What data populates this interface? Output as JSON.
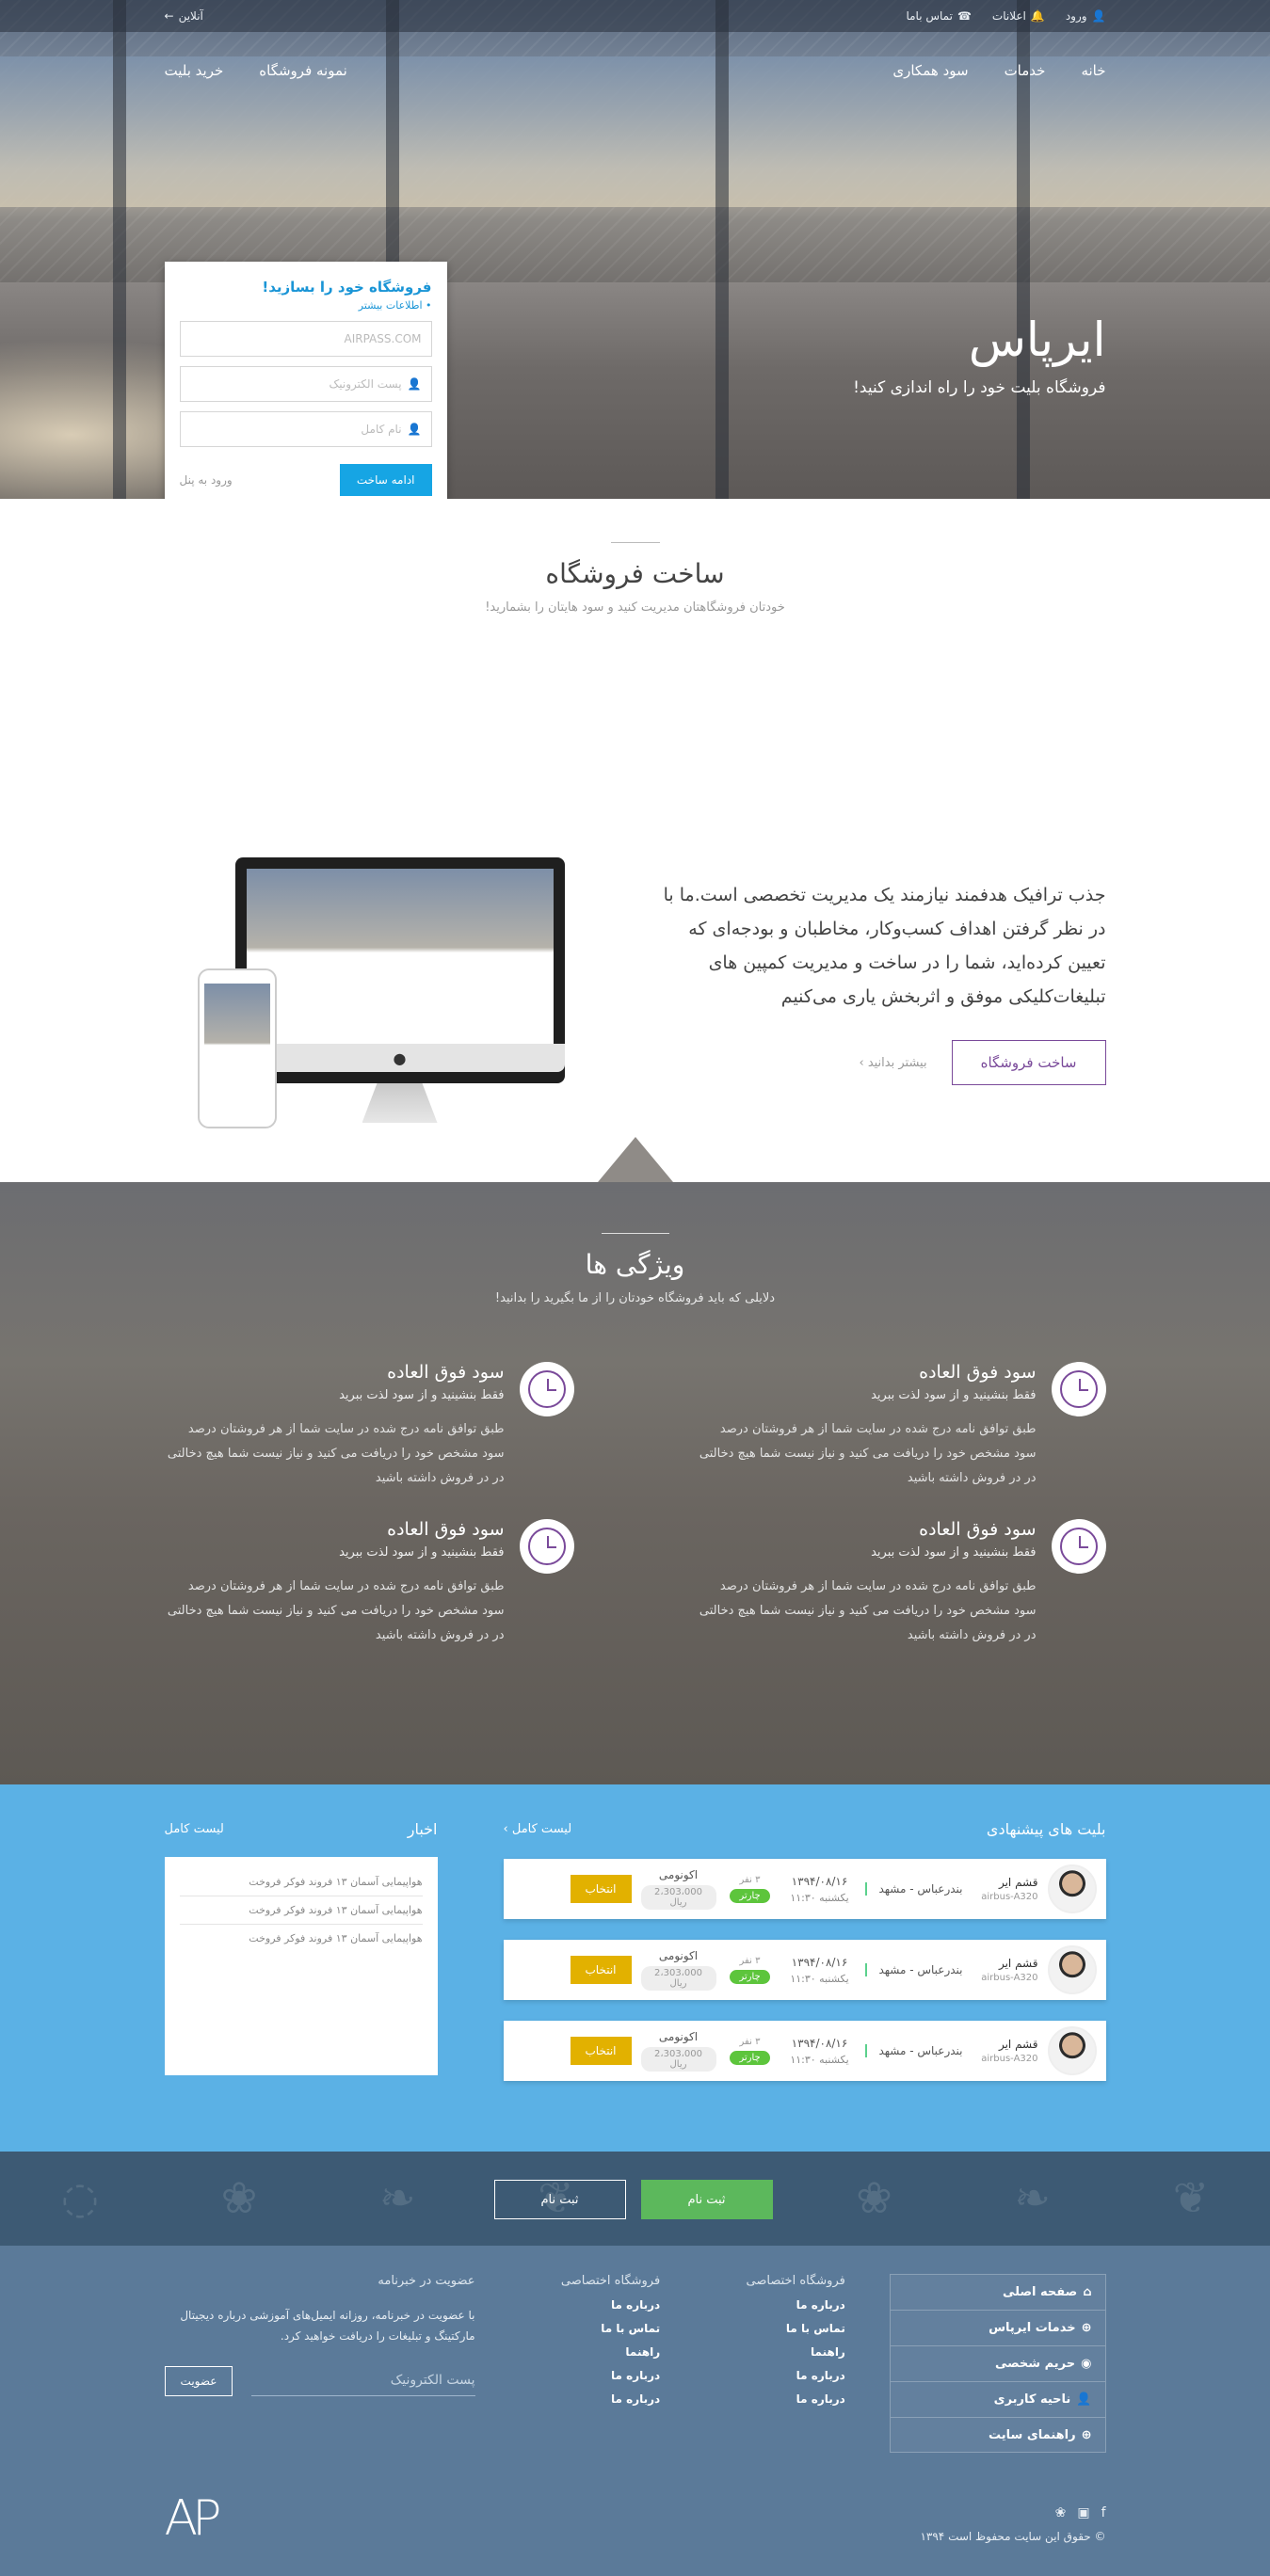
{
  "topbar": {
    "login": "ورود",
    "notifications": "اعلانات",
    "contact": "تماس باما",
    "online": "آنلاین"
  },
  "nav": {
    "right": [
      "خانه",
      "خدمات",
      "سود همکاری"
    ],
    "left": [
      "نمونه فروشگاه",
      "خرید بلیت"
    ]
  },
  "hero": {
    "title": "ایرپاس",
    "subtitle": "فروشگاه بلیت خود را راه اندازی کنید!"
  },
  "signup_form": {
    "title": "فروشگاه خود را بسازید!",
    "more": "• اطلاعات بیشتر",
    "domain_placeholder": "AIRPASS.COM",
    "email_placeholder": "پست الکترونیک",
    "name_placeholder": "نام کامل",
    "submit": "ادامه ساخت",
    "panel_login": "ورود به پنل"
  },
  "build": {
    "title": "ساخت فروشگاه",
    "subtitle": "خودتان فروشگاهتان مدیریت کنید و سود هایتان را بشمارید!",
    "description": "جذب ترافیک هدفمند نیازمند یک مدیریت تخصصی است.ما با در نظر گرفتن اهداف کسب‌وکار، مخاطبان و بودجه‌ای که تعیین کرده‌اید، شما را در ساخت و مدیریت کمپین های تبلیغات‌کلیکی موفق و اثربخش یاری می‌کنیم",
    "cta": "ساخت فروشگاه",
    "learn_more": "بیشتر بدانید"
  },
  "features": {
    "title": "ویژگی ها",
    "subtitle": "دلایلی که باید فروشگاه خودتان را از ما بگیرید را بدانید!",
    "items": [
      {
        "title": "سود فوق العاده",
        "subtitle": "فقط بنشینید و از سود لذت ببرید",
        "text": "طبق توافق نامه درج شده در سایت شما از هر فروشتان درصد سود مشخص خود را دریافت می کنید و نیاز نیست شما هیچ دخالتی در در فروش داشته باشید"
      },
      {
        "title": "سود فوق العاده",
        "subtitle": "فقط بنشینید و از سود لذت ببرید",
        "text": "طبق توافق نامه درج شده در سایت شما از هر فروشتان درصد سود مشخص خود را دریافت می کنید و نیاز نیست شما هیچ دخالتی در در فروش داشته باشید"
      },
      {
        "title": "سود فوق العاده",
        "subtitle": "فقط بنشینید و از سود لذت ببرید",
        "text": "طبق توافق نامه درج شده در سایت شما از هر فروشتان درصد سود مشخص خود را دریافت می کنید و نیاز نیست شما هیچ دخالتی در در فروش داشته باشید"
      },
      {
        "title": "سود فوق العاده",
        "subtitle": "فقط بنشینید و از سود لذت ببرید",
        "text": "طبق توافق نامه درج شده در سایت شما از هر فروشتان درصد سود مشخص خود را دریافت می کنید و نیاز نیست شما هیچ دخالتی در در فروش داشته باشید"
      }
    ]
  },
  "offers": {
    "title": "بلیت های پیشنهادی",
    "all_link": "لیست کامل",
    "tickets": [
      {
        "airline": "قشم ایر",
        "aircraft": "airbus-A320",
        "route": "بندرعباس - مشهد",
        "date": "۱۳۹۴/۰۸/۱۶",
        "time": "یکشنبه ۱۱:۳۰",
        "seats": "۳ نفر",
        "type": "چارتر",
        "class": "اکونومی",
        "price": "2،303،000 ریال",
        "select": "انتخاب"
      },
      {
        "airline": "قشم ایر",
        "aircraft": "airbus-A320",
        "route": "بندرعباس - مشهد",
        "date": "۱۳۹۴/۰۸/۱۶",
        "time": "یکشنبه ۱۱:۳۰",
        "seats": "۳ نفر",
        "type": "چارتر",
        "class": "اکونومی",
        "price": "2،303،000 ریال",
        "select": "انتخاب"
      },
      {
        "airline": "قشم ایر",
        "aircraft": "airbus-A320",
        "route": "بندرعباس - مشهد",
        "date": "۱۳۹۴/۰۸/۱۶",
        "time": "یکشنبه ۱۱:۳۰",
        "seats": "۳ نفر",
        "type": "چارتر",
        "class": "اکونومی",
        "price": "2،303،000 ریال",
        "select": "انتخاب"
      }
    ]
  },
  "news": {
    "title": "اخبار",
    "all_link": "لیست کامل",
    "items": [
      "هواپیمایی آسمان ۱۳ فروند فوکر فروخت",
      "هواپیمایی آسمان ۱۳ فروند فوکر فروخت",
      "هواپیمایی آسمان ۱۳ فروند فوکر فروخت"
    ]
  },
  "cta": {
    "register_primary": "ثبت نام",
    "register_secondary": "ثبت نام"
  },
  "footer": {
    "menu": [
      "صفحه اصلی",
      "خدمات ایرپاس",
      "حریم شخصی",
      "ناحیه کاربری",
      "راهنمای سایت"
    ],
    "col1_title": "فروشگاه اختصاصی",
    "col1_links": [
      "درباره ما",
      "تماس با ما",
      "راهنما",
      "درباره ما",
      "درباره ما"
    ],
    "col2_title": "فروشگاه اختصاصی",
    "col2_links": [
      "درباره ما",
      "تماس با ما",
      "راهنما",
      "درباره ما",
      "درباره ما"
    ],
    "newsletter_title": "عضویت در خبرنامه",
    "newsletter_text": "با عضویت در خبرنامه، روزانه ایمیل‌های آموزشی درباره دیجیتال مارکتینگ و تبلیغات را دریافت خواهید کرد.",
    "newsletter_placeholder": "پست الکترونیک",
    "newsletter_button": "عضویت",
    "copyright": "© حقوق این سایت محفوظ است ۱۳۹۴",
    "logo": "AP"
  },
  "colors": {
    "accent_blue": "#16a5e4",
    "purple": "#7a4a9a",
    "offers_bg": "#5bb1e5",
    "footer_bg": "#5b7a99"
  }
}
